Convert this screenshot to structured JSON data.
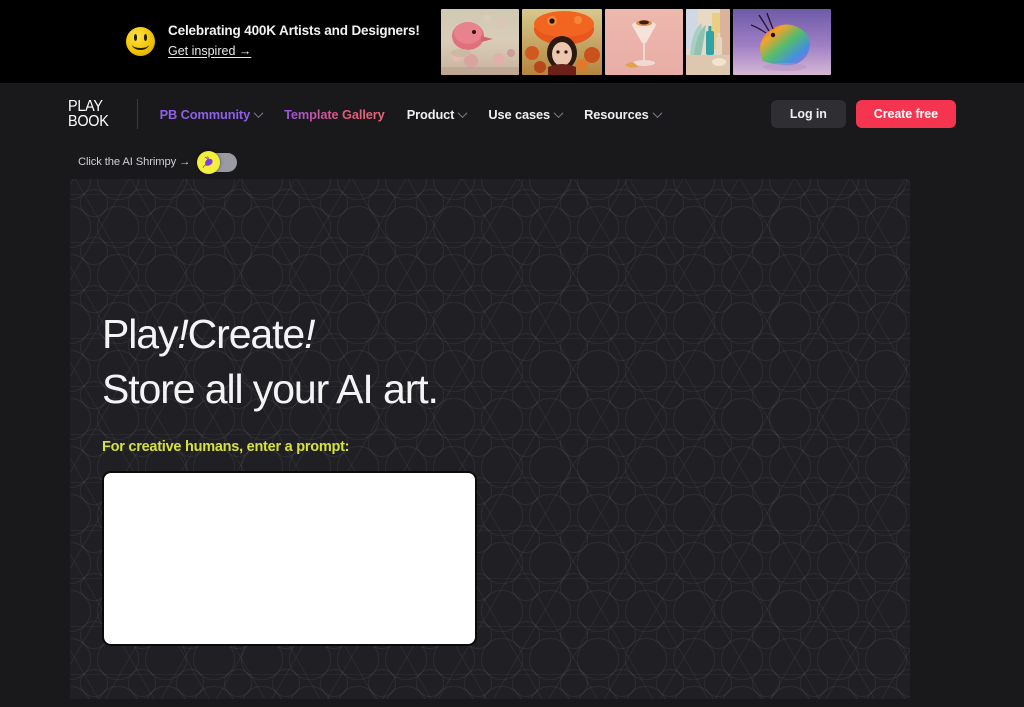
{
  "promo": {
    "icon": "smiley-face-icon",
    "title": "Celebrating 400K Artists and Designers!",
    "link_label": "Get inspired →",
    "thumbnails": [
      {
        "name": "thumb-pink-creature-landscape",
        "alt": "Pink balloon creature in surreal landscape"
      },
      {
        "name": "thumb-orange-frog-girl",
        "alt": "Girl with orange frog headpiece"
      },
      {
        "name": "thumb-cocktail-glass",
        "alt": "Pink cocktail in coupe glass"
      },
      {
        "name": "thumb-still-life-bottles",
        "alt": "Teal bottles still life"
      },
      {
        "name": "thumb-rainbow-shrimp",
        "alt": "Rainbow shrimp creature"
      }
    ]
  },
  "nav": {
    "logo_line1": "PLAY",
    "logo_line2": "BOOK",
    "items": [
      {
        "label": "PB Community",
        "accent": "purple",
        "has_chevron": true
      },
      {
        "label": "Template Gallery",
        "accent": "pink",
        "has_chevron": false
      },
      {
        "label": "Product",
        "accent": "white",
        "has_chevron": true
      },
      {
        "label": "Use cases",
        "accent": "white",
        "has_chevron": true
      },
      {
        "label": "Resources",
        "accent": "white",
        "has_chevron": true
      }
    ],
    "login_label": "Log in",
    "create_label": "Create free"
  },
  "shrimpy": {
    "label": "Click the AI Shrimpy →",
    "toggle_state": "off"
  },
  "hero": {
    "headline_line1_a": "Play",
    "headline_line1_b": "!",
    "headline_line1_c": "Create",
    "headline_line1_d": "!",
    "headline_line2": "Store all your AI art.",
    "prompt_label": "For creative humans, enter a prompt:",
    "prompt_value": "",
    "prompt_placeholder": ""
  },
  "colors": {
    "banner_bg": "#000000",
    "page_bg": "#19191c",
    "hero_bg": "#202024",
    "accent_purple": "#8f5fe8",
    "accent_pink": "#e0577f",
    "accent_red": "#f5344f",
    "accent_yellow": "#d8e23c",
    "shrimpy_yellow": "#f3ef3a"
  }
}
